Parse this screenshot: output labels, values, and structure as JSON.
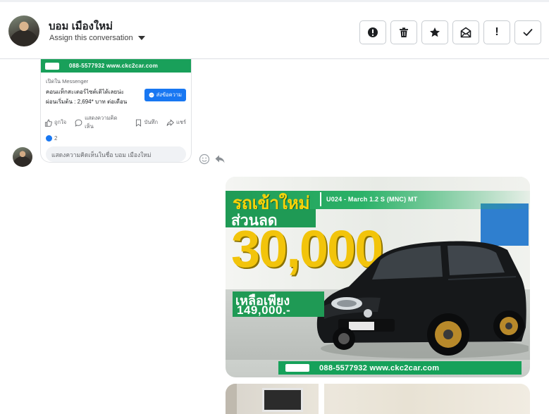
{
  "header": {
    "contact_name": "บอม เมืองใหม่",
    "assign_label": "Assign this conversation"
  },
  "actions": [
    {
      "name": "mark-spam-button",
      "icon": "alert-circle-icon"
    },
    {
      "name": "delete-button",
      "icon": "trash-icon"
    },
    {
      "name": "star-button",
      "icon": "star-icon"
    },
    {
      "name": "mark-unread-button",
      "icon": "envelope-icon"
    },
    {
      "name": "mark-important-button",
      "icon": "exclamation-icon",
      "glyph": "!"
    },
    {
      "name": "mark-done-button",
      "icon": "check-icon"
    }
  ],
  "shared_post": {
    "banner_text": "088-5577932 www.ckc2car.com",
    "source": "เปิดใน Messenger",
    "desc_line1": "คอนแท็กสะเตอร์ไซต์เดิได้เลยน่ะ",
    "desc_line2": "ผ่อนเริ่มต้น : 2,694* บาท ต่อเดือน",
    "send_label": "ส่งข้อความ",
    "like_label": "ถูกใจ",
    "comment_label": "แสดงความคิดเห็น",
    "save_label": "บันทึก",
    "share_label": "แชร์",
    "reaction_count": "2",
    "comment_placeholder": "แสดงความคิดเห็นในชื่อ บอม เมืองใหม่"
  },
  "car_ad": {
    "headline": "รถเข้าใหม่",
    "model": "U024 - March 1.2 S (MNC) MT",
    "discount_label": "ส่วนลด",
    "discount_amount": "30,000",
    "price_label": "เหลือเพียง",
    "price": "149,000.-",
    "footer_text": "088-5577932 www.ckc2car.com"
  },
  "colors": {
    "brand_green": "#1f9a55",
    "accent_yellow": "#f2c40b",
    "messenger_blue": "#1877f2"
  }
}
